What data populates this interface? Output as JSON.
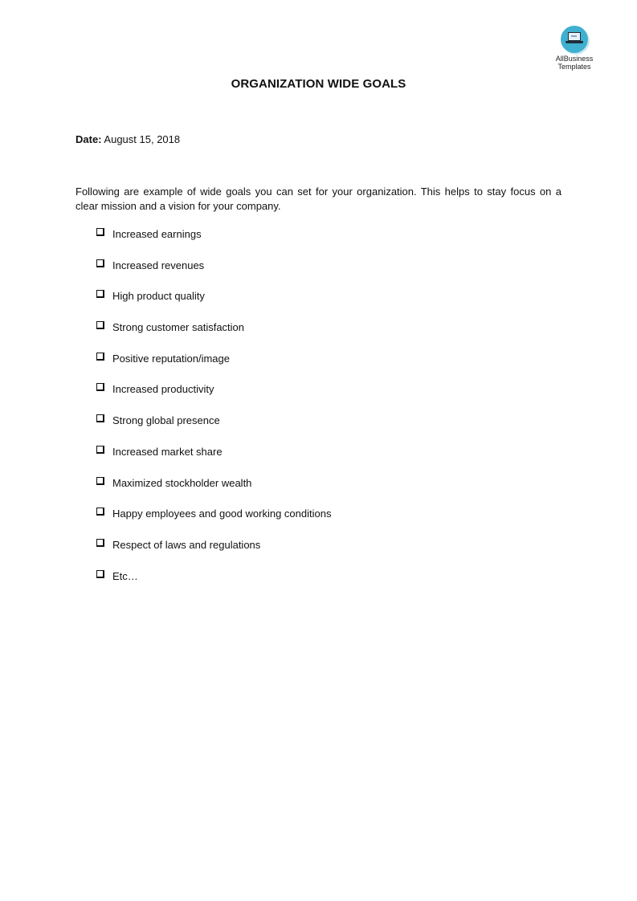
{
  "logo": {
    "line1": "AllBusiness",
    "line2": "Templates",
    "accent_color": "#3fb0cf"
  },
  "document": {
    "title": "ORGANIZATION WIDE GOALS",
    "date_label": "Date:",
    "date_value": "August 15, 2018",
    "intro": "Following are example of wide goals you can set for your organization. This helps to stay focus on a clear mission and a vision for your company.",
    "goals": [
      "Increased earnings",
      "Increased revenues",
      "High product quality",
      "Strong customer satisfaction",
      "Positive reputation/image",
      "Increased productivity",
      "Strong global presence",
      "Increased market share",
      "Maximized stockholder wealth",
      "Happy employees and good working conditions",
      "Respect of laws and regulations",
      "Etc…"
    ]
  }
}
